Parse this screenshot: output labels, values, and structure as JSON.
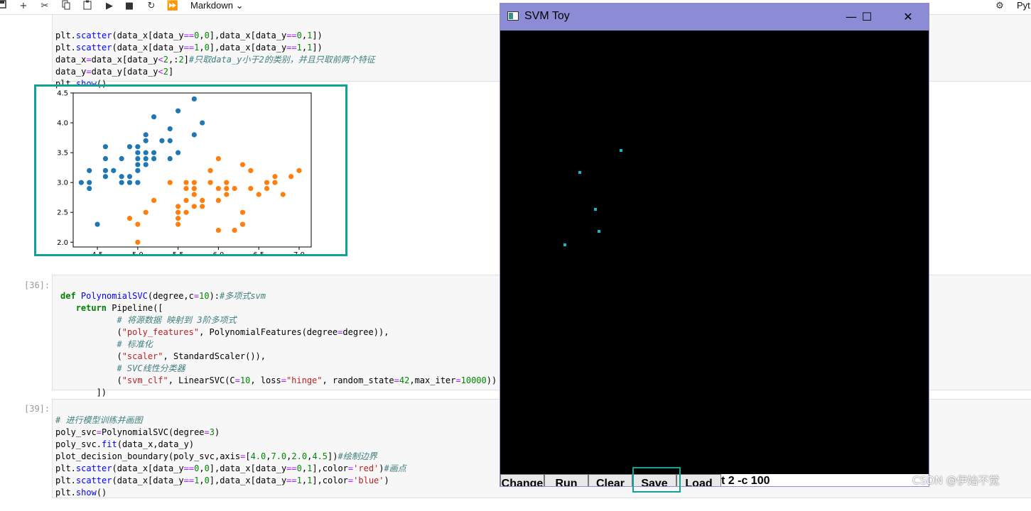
{
  "toolbar": {
    "cell_type": "Markdown",
    "kernel_partial": "Pyt",
    "icons": [
      "save-icon",
      "add-icon",
      "cut-icon",
      "copy-icon",
      "paste-icon",
      "run-icon",
      "stop-icon",
      "restart-icon",
      "fast-forward-icon",
      "bug-icon"
    ]
  },
  "cell_top": {
    "lines": [
      "plt.scatter(data_x[data_y==0,0],data_x[data_y==0,1])",
      "plt.scatter(data_x[data_y==1,0],data_x[data_y==1,1])",
      "data_x=data_x[data_y<2,:2]#只取data_y小于2的类别，并且只取前两个特征",
      "data_y=data_y[data_y<2]",
      "plt.show()"
    ]
  },
  "chart_data": {
    "type": "scatter",
    "title": "",
    "xlabel": "",
    "ylabel": "",
    "xlim": [
      4.2,
      7.15
    ],
    "ylim": [
      1.92,
      4.5
    ],
    "x_ticks": [
      "4.5",
      "5.0",
      "5.5",
      "6.0",
      "6.5",
      "7.0"
    ],
    "y_ticks": [
      "2.0",
      "2.5",
      "3.0",
      "3.5",
      "4.0",
      "4.5"
    ],
    "grid": false,
    "series": [
      {
        "color": "#1f77b4",
        "points": [
          [
            4.3,
            3.0
          ],
          [
            4.4,
            2.9
          ],
          [
            4.4,
            3.0
          ],
          [
            4.4,
            3.2
          ],
          [
            4.5,
            2.3
          ],
          [
            4.6,
            3.1
          ],
          [
            4.6,
            3.2
          ],
          [
            4.6,
            3.4
          ],
          [
            4.6,
            3.6
          ],
          [
            4.7,
            3.2
          ],
          [
            4.8,
            3.0
          ],
          [
            4.8,
            3.1
          ],
          [
            4.8,
            3.4
          ],
          [
            4.9,
            3.0
          ],
          [
            4.9,
            3.1
          ],
          [
            4.9,
            3.6
          ],
          [
            5.0,
            3.0
          ],
          [
            5.0,
            3.2
          ],
          [
            5.0,
            3.3
          ],
          [
            5.0,
            3.4
          ],
          [
            5.0,
            3.5
          ],
          [
            5.0,
            3.6
          ],
          [
            5.1,
            3.3
          ],
          [
            5.1,
            3.4
          ],
          [
            5.1,
            3.5
          ],
          [
            5.1,
            3.7
          ],
          [
            5.1,
            3.8
          ],
          [
            5.2,
            3.4
          ],
          [
            5.2,
            3.5
          ],
          [
            5.2,
            4.1
          ],
          [
            5.3,
            3.7
          ],
          [
            5.4,
            3.4
          ],
          [
            5.4,
            3.7
          ],
          [
            5.4,
            3.9
          ],
          [
            5.5,
            3.5
          ],
          [
            5.5,
            4.2
          ],
          [
            5.7,
            3.8
          ],
          [
            5.7,
            4.4
          ],
          [
            5.8,
            4.0
          ]
        ]
      },
      {
        "color": "#ff7f0e",
        "points": [
          [
            4.9,
            2.4
          ],
          [
            5.0,
            2.0
          ],
          [
            5.0,
            2.3
          ],
          [
            5.1,
            2.5
          ],
          [
            5.2,
            2.7
          ],
          [
            5.4,
            3.0
          ],
          [
            5.5,
            2.3
          ],
          [
            5.5,
            2.4
          ],
          [
            5.5,
            2.5
          ],
          [
            5.5,
            2.6
          ],
          [
            5.6,
            2.5
          ],
          [
            5.6,
            2.7
          ],
          [
            5.6,
            2.9
          ],
          [
            5.6,
            3.0
          ],
          [
            5.7,
            2.6
          ],
          [
            5.7,
            2.8
          ],
          [
            5.7,
            2.9
          ],
          [
            5.7,
            3.0
          ],
          [
            5.8,
            2.6
          ],
          [
            5.8,
            2.7
          ],
          [
            5.9,
            3.0
          ],
          [
            5.9,
            3.2
          ],
          [
            6.0,
            2.2
          ],
          [
            6.0,
            2.7
          ],
          [
            6.0,
            2.9
          ],
          [
            6.0,
            3.4
          ],
          [
            6.1,
            2.8
          ],
          [
            6.1,
            2.9
          ],
          [
            6.1,
            3.0
          ],
          [
            6.2,
            2.2
          ],
          [
            6.2,
            2.9
          ],
          [
            6.3,
            2.3
          ],
          [
            6.3,
            2.5
          ],
          [
            6.3,
            3.3
          ],
          [
            6.4,
            2.9
          ],
          [
            6.4,
            3.2
          ],
          [
            6.5,
            2.8
          ],
          [
            6.6,
            2.9
          ],
          [
            6.6,
            3.0
          ],
          [
            6.7,
            3.0
          ],
          [
            6.7,
            3.1
          ],
          [
            6.8,
            2.8
          ],
          [
            6.9,
            3.1
          ],
          [
            7.0,
            3.2
          ]
        ]
      }
    ]
  },
  "cell36": {
    "prompt": "[36]:",
    "lines": [
      "def PolynomialSVC(degree,c=10):#多项式svm",
      "    return Pipeline([",
      "            # 将源数据 映射到 3阶多项式",
      "            (\"poly_features\", PolynomialFeatures(degree=degree)),",
      "            # 标准化",
      "            (\"scaler\", StandardScaler()),",
      "            # SVC线性分类器",
      "            (\"svm_clf\", LinearSVC(C=10, loss=\"hinge\", random_state=42,max_iter=10000))",
      "        ])"
    ]
  },
  "cell39": {
    "prompt": "[39]:",
    "lines": [
      "# 进行模型训练并画图",
      "poly_svc=PolynomialSVC(degree=3)",
      "poly_svc.fit(data_x,data_y)",
      "plot_decision_boundary(poly_svc,axis=[4.0,7.0,2.0,4.5])#绘制边界",
      "plt.scatter(data_x[data_y==0,0],data_x[data_y==0,1],color='red')#画点",
      "plt.scatter(data_x[data_y==1,0],data_x[data_y==1,1],color='blue')",
      "plt.show()"
    ]
  },
  "svm_window": {
    "title": "SVM Toy",
    "minimize": "—",
    "maximize": "☐",
    "close": "✕",
    "buttons": [
      "Change",
      "Run",
      "Clear",
      "Save",
      "Load"
    ],
    "param_text": "t 2 -c 100",
    "point_color": "#10b8c8",
    "points_count": 5
  },
  "watermark": "CSDN @伊始不觉"
}
